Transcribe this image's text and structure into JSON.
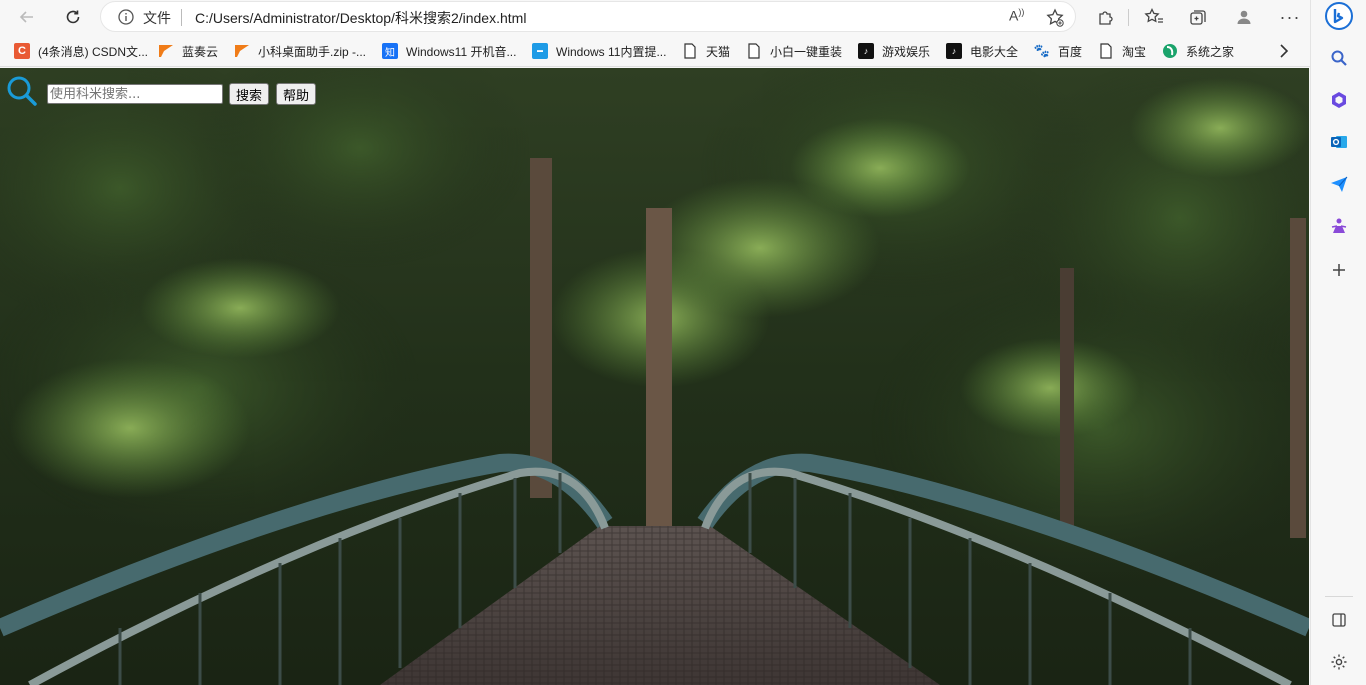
{
  "browser": {
    "address_file_label": "文件",
    "url": "C:/Users/Administrator/Desktop/科米搜索2/index.html"
  },
  "bookmarks": [
    {
      "label": "(4条消息) CSDN文...",
      "icon": "csdn-icon",
      "color": "#e95a34"
    },
    {
      "label": "蓝奏云",
      "icon": "lanzou-icon",
      "color": "#f07c18"
    },
    {
      "label": "小科桌面助手.zip -...",
      "icon": "lanzou-icon",
      "color": "#f07c18"
    },
    {
      "label": "Windows11 开机音...",
      "icon": "zhihu-icon",
      "color": "#1772f6"
    },
    {
      "label": "Windows 11内置提...",
      "icon": "site-icon",
      "color": "#1e9be6"
    },
    {
      "label": "天猫",
      "icon": "page-icon",
      "color": "#ffffff"
    },
    {
      "label": "小白一键重装",
      "icon": "page-icon",
      "color": "#ffffff"
    },
    {
      "label": "游戏娱乐",
      "icon": "tiktok-icon",
      "color": "#111111"
    },
    {
      "label": "电影大全",
      "icon": "tiktok-icon",
      "color": "#111111"
    },
    {
      "label": "百度",
      "icon": "baidu-paw-icon",
      "color": "#2932e1"
    },
    {
      "label": "淘宝",
      "icon": "page-icon",
      "color": "#ffffff"
    },
    {
      "label": "系统之家",
      "icon": "xitong-icon",
      "color": "#1aa36b"
    }
  ],
  "page": {
    "search_placeholder": "使用科米搜索...",
    "search_button": "搜索",
    "help_button": "帮助",
    "accent_color": "#1a9bd7"
  }
}
